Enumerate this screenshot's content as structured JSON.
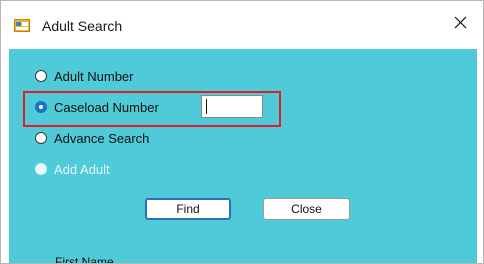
{
  "window": {
    "title": "Adult Search",
    "app_icon": "form-window-icon",
    "close_icon": "close-x-icon",
    "background_color": "#4ecad8",
    "highlight_color": "#e01e27"
  },
  "search_options": [
    {
      "label": "Adult Number",
      "checked": false,
      "enabled": true
    },
    {
      "label": "Caseload Number",
      "checked": true,
      "enabled": true
    },
    {
      "label": "Advance Search",
      "checked": false,
      "enabled": true
    },
    {
      "label": "Add Adult",
      "checked": false,
      "enabled": false
    }
  ],
  "caseload_input": {
    "value": "",
    "placeholder": ""
  },
  "buttons": {
    "find": "Find",
    "close": "Close"
  },
  "partial": {
    "first_name_label": "First Name"
  }
}
